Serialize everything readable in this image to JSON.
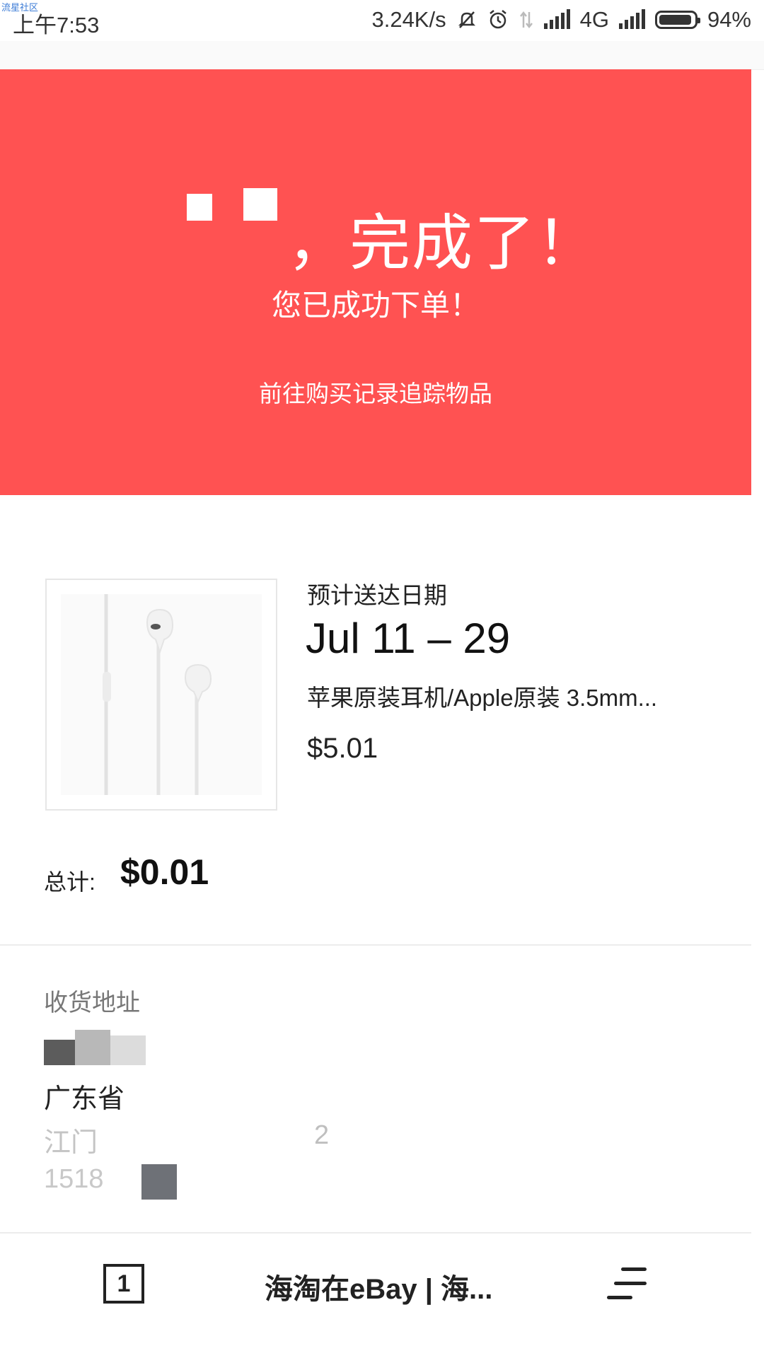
{
  "status_bar": {
    "watermark": "流星社区",
    "time": "上午7:53",
    "speed": "3.24K/s",
    "network": "4G",
    "battery": "94%",
    "battery_level": 0.94
  },
  "hero": {
    "title_suffix": "，完成了！",
    "subtitle": "您已成功下单！",
    "link": "前往购买记录追踪物品"
  },
  "order": {
    "eta_label": "预计送达日期",
    "eta_date": "Jul 11 – 29",
    "product_title": "苹果原装耳机/Apple原装 3.5mm...",
    "price": "$5.01",
    "total_label": "总计:",
    "total_value": "$0.01"
  },
  "address": {
    "label": "收货地址",
    "line_province": "广东省",
    "line_city": "江门",
    "line_frag": "2",
    "line_phone": "1518"
  },
  "bottom_bar": {
    "tab_count": "1",
    "page_title": "海淘在eBay | 海..."
  },
  "colors": {
    "accent": "#ff5252",
    "text": "#1a1a1a",
    "muted": "#777777"
  },
  "icons": [
    "mute-icon",
    "alarm-icon",
    "data-arrows-icon",
    "signal-icon",
    "battery-icon",
    "earphones-image",
    "tab-count-icon",
    "menu-icon"
  ]
}
